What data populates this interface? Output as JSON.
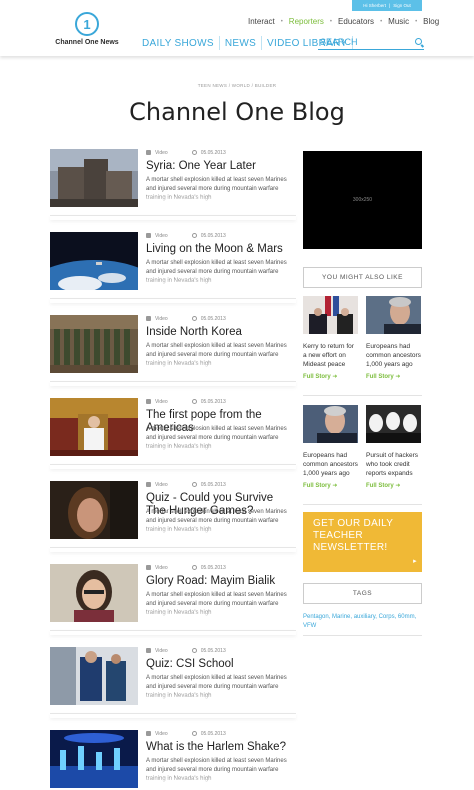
{
  "user_bar": {
    "greeting": "Hi Sherbert",
    "sign_out": "Sign Out"
  },
  "logo": {
    "mark": "1",
    "name": "Channel One News"
  },
  "top_nav": [
    "Interact",
    "Reporters",
    "Educators",
    "Music",
    "Blog"
  ],
  "main_nav": [
    "DAILY SHOWS",
    "NEWS",
    "VIDEO LIBRARY"
  ],
  "search": {
    "placeholder": "SEARCH"
  },
  "breadcrumb": "TEEN NEWS  /  WORLD  /  BUILDER",
  "page_title": "Channel One Blog",
  "articles": [
    {
      "type": "Video",
      "date": "05.05.2013",
      "title": "Syria: One Year Later",
      "excerpt": "A mortar shell explosion killed at least seven Marines and injured several more during mountain warfare training in Nevada's high"
    },
    {
      "type": "Video",
      "date": "05.05.2013",
      "title": "Living on the Moon & Mars",
      "excerpt": "A mortar shell explosion killed at least seven Marines and injured several more during mountain warfare training in Nevada's high"
    },
    {
      "type": "Video",
      "date": "05.05.2013",
      "title": "Inside North Korea",
      "excerpt": "A mortar shell explosion killed at least seven Marines and injured several more during mountain warfare training in Nevada's high"
    },
    {
      "type": "Video",
      "date": "05.05.2013",
      "title": "The first pope from the Americas",
      "excerpt": "A mortar shell explosion killed at least seven Marines and injured several more during mountain warfare training in Nevada's high"
    },
    {
      "type": "Video",
      "date": "05.05.2013",
      "title": "Quiz - Could you Survive The Hunger Games?",
      "excerpt": "A mortar shell explosion killed at least seven Marines and injured several more during mountain warfare training in Nevada's high"
    },
    {
      "type": "Video",
      "date": "05.05.2013",
      "title": "Glory Road: Mayim Bialik",
      "excerpt": "A mortar shell explosion killed at least seven Marines and injured several more during mountain warfare training in Nevada's high"
    },
    {
      "type": "Video",
      "date": "05.05.2013",
      "title": "Quiz: CSI School",
      "excerpt": "A mortar shell explosion killed at least seven Marines and injured several more during mountain warfare training in Nevada's high"
    },
    {
      "type": "Video",
      "date": "05.05.2013",
      "title": "What is the Harlem Shake?",
      "excerpt": "A mortar shell explosion killed at least seven Marines and injured several more during mountain warfare training in Nevada's high"
    }
  ],
  "ad": {
    "label": "300x250"
  },
  "related": {
    "heading": "YOU MIGHT ALSO LIKE",
    "items": [
      {
        "text": "Kerry to return for a new effort on Mideast peace",
        "more": "Full Story"
      },
      {
        "text": "Europeans had common ancestors 1,000 years ago",
        "more": "Full Story"
      },
      {
        "text": "Europeans had common ancestors 1,000 years ago",
        "more": "Full Story"
      },
      {
        "text": "Pursuit of hackers who took credit reports expands",
        "more": "Full Story"
      }
    ]
  },
  "newsletter": {
    "text": "GET OUR DAILY TEACHER NEWSLETTER!",
    "arrow": "▸"
  },
  "tags": {
    "heading": "TAGS",
    "list": "Pentagon, Marine, auxiliary, Corps, 60mm, VFW"
  },
  "colors": {
    "accent": "#3aa7d9",
    "green": "#7cbd3c",
    "newsletter": "#f0b936"
  }
}
